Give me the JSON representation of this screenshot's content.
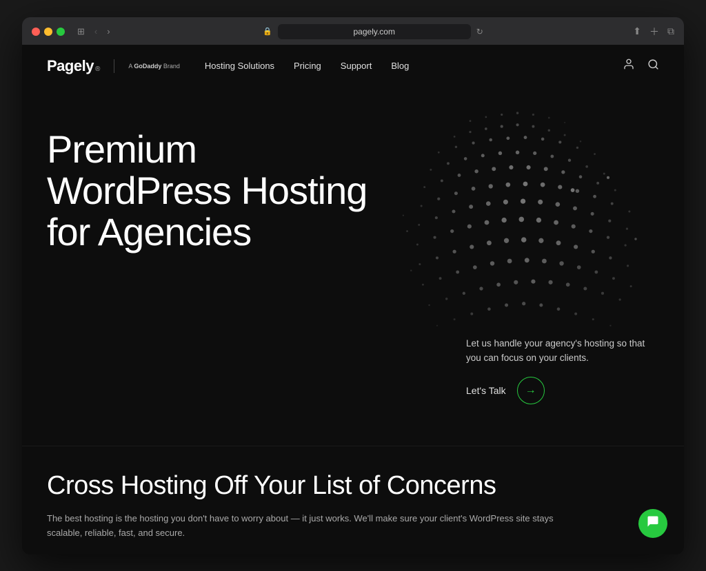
{
  "browser": {
    "url": "pagely.com",
    "back_label": "‹",
    "forward_label": "›",
    "view_label": "⊞"
  },
  "nav": {
    "logo": "Pagely",
    "logo_sup": "®",
    "godaddy": "A GoDaddy Brand",
    "links": [
      {
        "label": "Hosting Solutions",
        "id": "hosting-solutions"
      },
      {
        "label": "Pricing",
        "id": "pricing"
      },
      {
        "label": "Support",
        "id": "support"
      },
      {
        "label": "Blog",
        "id": "blog"
      }
    ]
  },
  "hero": {
    "title": "Premium WordPress Hosting for Agencies",
    "description": "Let us handle your agency's hosting so that you can focus on your clients.",
    "cta_label": "Let's Talk"
  },
  "cross_hosting": {
    "title": "Cross Hosting Off Your List of Concerns",
    "description": "The best hosting is the hosting you don't have to worry about — it just works. We'll make sure your client's WordPress site stays scalable, reliable, fast, and secure."
  },
  "chat": {
    "icon": "💬"
  }
}
